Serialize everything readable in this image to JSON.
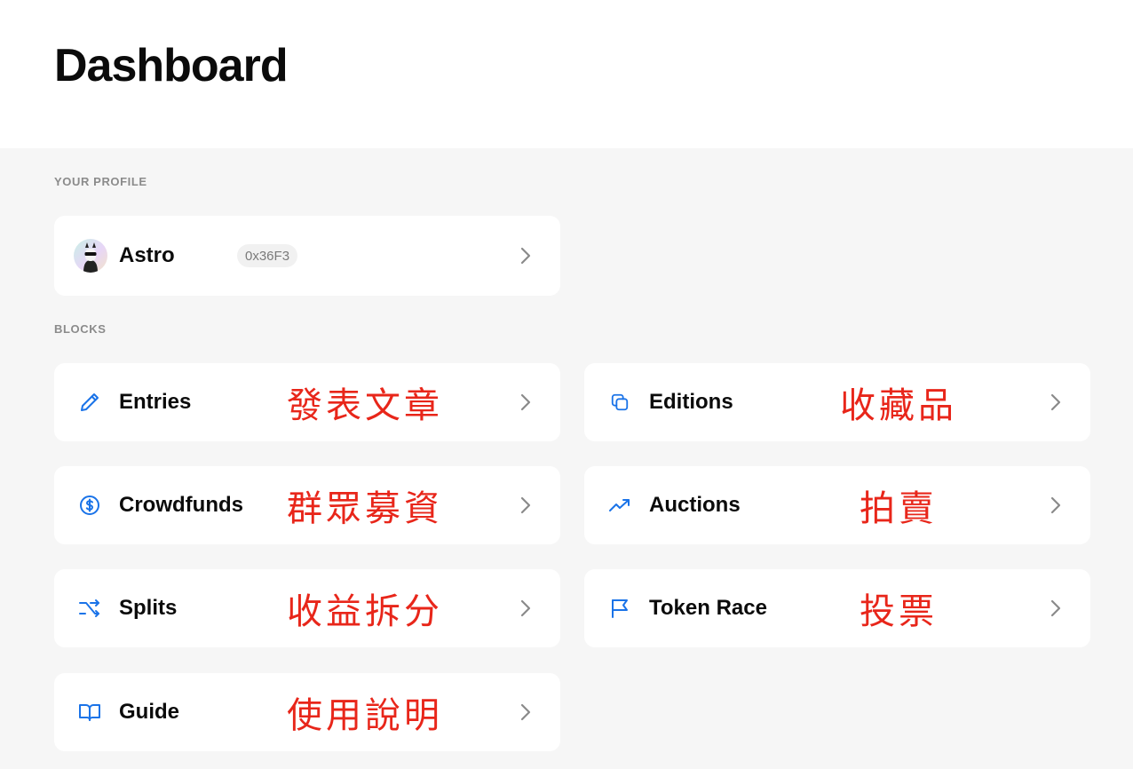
{
  "header": {
    "title": "Dashboard"
  },
  "profile_section": {
    "label": "YOUR PROFILE",
    "name": "Astro",
    "address": "0x36F3"
  },
  "blocks_section": {
    "label": "BLOCKS",
    "items": [
      {
        "label": "Entries",
        "icon": "pencil-icon",
        "annotation": "發表文章"
      },
      {
        "label": "Editions",
        "icon": "copy-icon",
        "annotation": "收藏品"
      },
      {
        "label": "Crowdfunds",
        "icon": "dollar-circle-icon",
        "annotation": "群眾募資"
      },
      {
        "label": "Auctions",
        "icon": "trending-up-icon",
        "annotation": "拍賣"
      },
      {
        "label": "Splits",
        "icon": "shuffle-icon",
        "annotation": "收益拆分"
      },
      {
        "label": "Token Race",
        "icon": "flag-icon",
        "annotation": "投票"
      },
      {
        "label": "Guide",
        "icon": "book-open-icon",
        "annotation": "使用說明"
      }
    ]
  },
  "colors": {
    "accent": "#1a73e8",
    "annotation": "#e8261a",
    "background": "#f6f6f6",
    "card": "#ffffff",
    "section_label": "#8b8b8b",
    "chevron": "#8a8a8a"
  }
}
